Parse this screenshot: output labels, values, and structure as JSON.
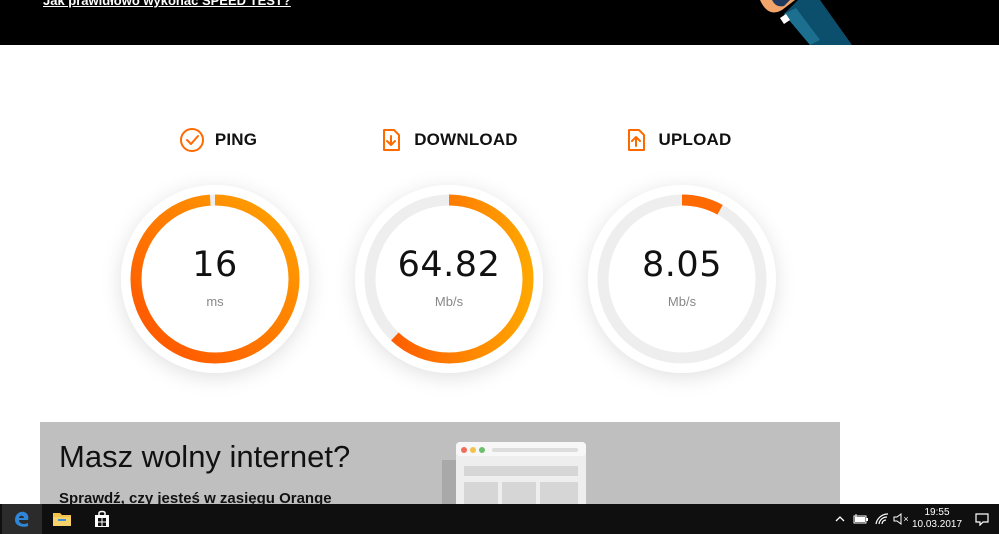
{
  "banner": {
    "link_text": "Jak prawidłowo wykonać SPEED TEST?"
  },
  "metrics": [
    {
      "id": "ping",
      "title": "PING",
      "icon": "clock-icon",
      "value": "16",
      "unit": "ms",
      "fill_fraction": 0.99
    },
    {
      "id": "download",
      "title": "DOWNLOAD",
      "icon": "download-icon",
      "value": "64.82",
      "unit": "Mb/s",
      "fill_fraction": 0.62
    },
    {
      "id": "upload",
      "title": "UPLOAD",
      "icon": "upload-icon",
      "value": "8.05",
      "unit": "Mb/s",
      "fill_fraction": 0.08
    }
  ],
  "promo": {
    "title": "Masz wolny internet?",
    "subtitle": "Sprawdź, czy jesteś w zasięgu Orange"
  },
  "taskbar": {
    "apps": [
      "edge-icon",
      "file-explorer-icon",
      "store-icon"
    ],
    "tray_icons": [
      "chevron-up-icon",
      "battery-icon",
      "wifi-icon",
      "volume-muted-icon",
      "notifications-icon"
    ],
    "volume_mark": "×",
    "time": "19:55",
    "date": "10.03.2017"
  },
  "colors": {
    "accent_start": "#ff5a00",
    "accent_end": "#ffa500",
    "track": "#eeeeee",
    "banner_bg": "#000000",
    "promo_bg": "#bfbfbf",
    "taskbar_bg": "#0f0f0f"
  }
}
